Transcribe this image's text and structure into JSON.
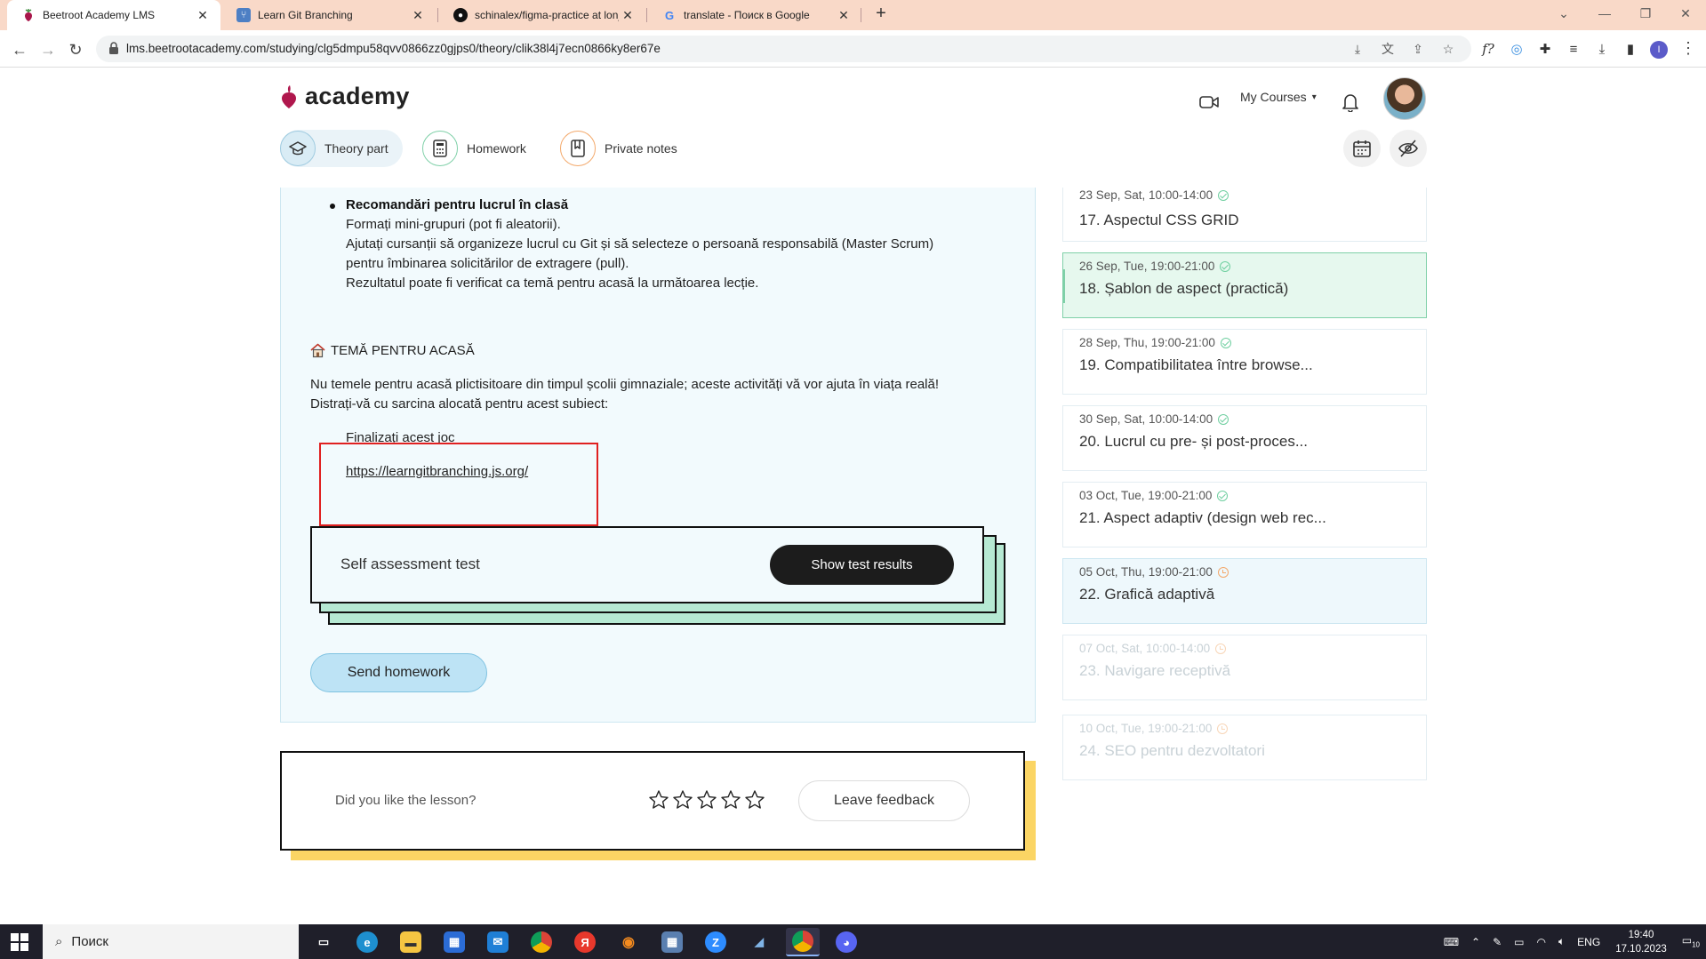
{
  "browser": {
    "tabs": [
      {
        "title": "Beetroot Academy LMS",
        "active": true,
        "icon": "beetroot-favicon"
      },
      {
        "title": "Learn Git Branching",
        "active": false,
        "icon": "git-favicon"
      },
      {
        "title": "schinalex/figma-practice at lon_",
        "active": false,
        "icon": "github-favicon"
      },
      {
        "title": "translate - Поиск в Google",
        "active": false,
        "icon": "google-favicon"
      }
    ],
    "new_tab": "+",
    "url": "lms.beetrootacademy.com/studying/clg5dmpu58qvv0866zz0gjps0/theory/clik38l4j7ecn0866ky8er67e",
    "profile_initial": "I"
  },
  "header": {
    "logo_text": "academy",
    "my_courses": "My Courses",
    "tabs": [
      {
        "label": "Theory part",
        "active": true
      },
      {
        "label": "Homework",
        "active": false
      },
      {
        "label": "Private notes",
        "active": false
      }
    ]
  },
  "content": {
    "bullet_title": "Recomandări pentru lucrul în clasă",
    "bullet_lines": [
      "Formați mini-grupuri (pot fi aleatorii).",
      "Ajutați cursanții să organizeze lucrul cu Git și să selecteze o persoană responsabilă (Master Scrum)",
      "pentru îmbinarea solicitărilor de extragere (pull).",
      "Rezultatul poate fi verificat ca temă pentru acasă la următoarea lecție."
    ],
    "homework_heading": "TEMĂ PENTRU ACASĂ",
    "homework_paragraph": [
      "Nu temele pentru acasă plictisitoare din timpul școlii gimnaziale; aceste activități vă vor ajuta în viața reală!",
      "Distrați-vă cu sarcina alocată pentru acest subiect:"
    ],
    "task_text": "Finalizați acest joc",
    "task_link": "https://learngitbranching.js.org/",
    "self_assessment_label": "Self assessment test",
    "show_results_button": "Show test results",
    "send_homework_button": "Send homework"
  },
  "feedback": {
    "question": "Did you like the lesson?",
    "star_count": 5,
    "rating": 0,
    "button": "Leave feedback"
  },
  "lessons": [
    {
      "date": "23 Sep, Sat, 10:00-14:00",
      "title": "17. Aspectul CSS GRID",
      "status": "done",
      "state": "past"
    },
    {
      "date": "26 Sep, Tue, 19:00-21:00",
      "title": "18. Șablon de aspect (practică)",
      "status": "done",
      "state": "current"
    },
    {
      "date": "28 Sep, Thu, 19:00-21:00",
      "title": "19. Compatibilitatea între browse...",
      "status": "done",
      "state": "past"
    },
    {
      "date": "30 Sep, Sat, 10:00-14:00",
      "title": "20. Lucrul cu pre- și post-proces...",
      "status": "done",
      "state": "past"
    },
    {
      "date": "03 Oct, Tue, 19:00-21:00",
      "title": "21. Aspect adaptiv (design web rec...",
      "status": "done",
      "state": "past"
    },
    {
      "date": "05 Oct, Thu, 19:00-21:00",
      "title": "22. Grafică adaptivă",
      "status": "pending",
      "state": "upcoming"
    },
    {
      "date": "07 Oct, Sat, 10:00-14:00",
      "title": "23. Navigare receptivă",
      "status": "pending",
      "state": "locked"
    },
    {
      "date": "10 Oct, Tue, 19:00-21:00",
      "title": "24. SEO pentru dezvoltatori",
      "status": "pending",
      "state": "locked"
    }
  ],
  "taskbar": {
    "search_label": "Поиск",
    "language": "ENG",
    "time": "19:40",
    "date": "17.10.2023",
    "notifications": "10"
  },
  "colors": {
    "content_bg": "#f2fafd",
    "card_shadow_green": "#b6e9d3",
    "feedback_shadow_yellow": "#fbd564",
    "highlight_red": "#e02020",
    "current_lesson_bg": "#e6f8ee",
    "tabstrip_bg": "#f9d9c8"
  }
}
